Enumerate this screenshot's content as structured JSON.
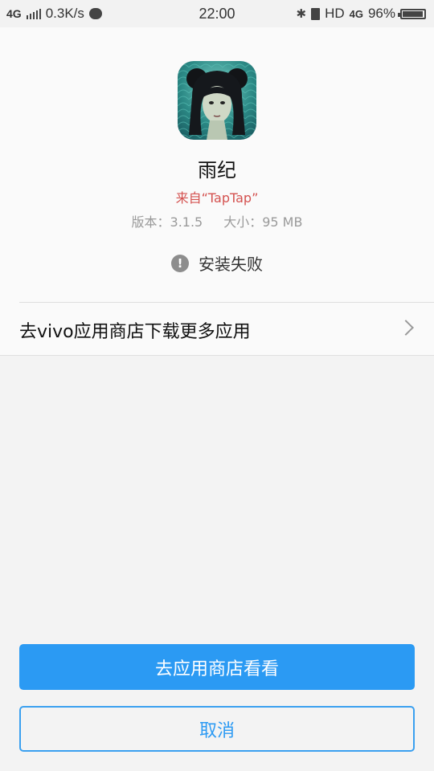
{
  "status_bar": {
    "network_type": "4G",
    "speed": "0.3K/s",
    "time": "22:00",
    "hd_label": "HD",
    "network_type_right": "4G",
    "battery": "96%",
    "battery_level": 0.96
  },
  "app": {
    "name": "雨纪",
    "source": "来自“TapTap”",
    "version": "版本：3.1.5",
    "size": "大小：95 MB",
    "install_status": "安装失败",
    "warn_symbol": "!"
  },
  "store_link": {
    "label": "去vivo应用商店下载更多应用"
  },
  "buttons": {
    "primary": "去应用商店看看",
    "cancel": "取消"
  },
  "colors": {
    "accent": "#2b9af3",
    "source_red": "#d4514f"
  }
}
